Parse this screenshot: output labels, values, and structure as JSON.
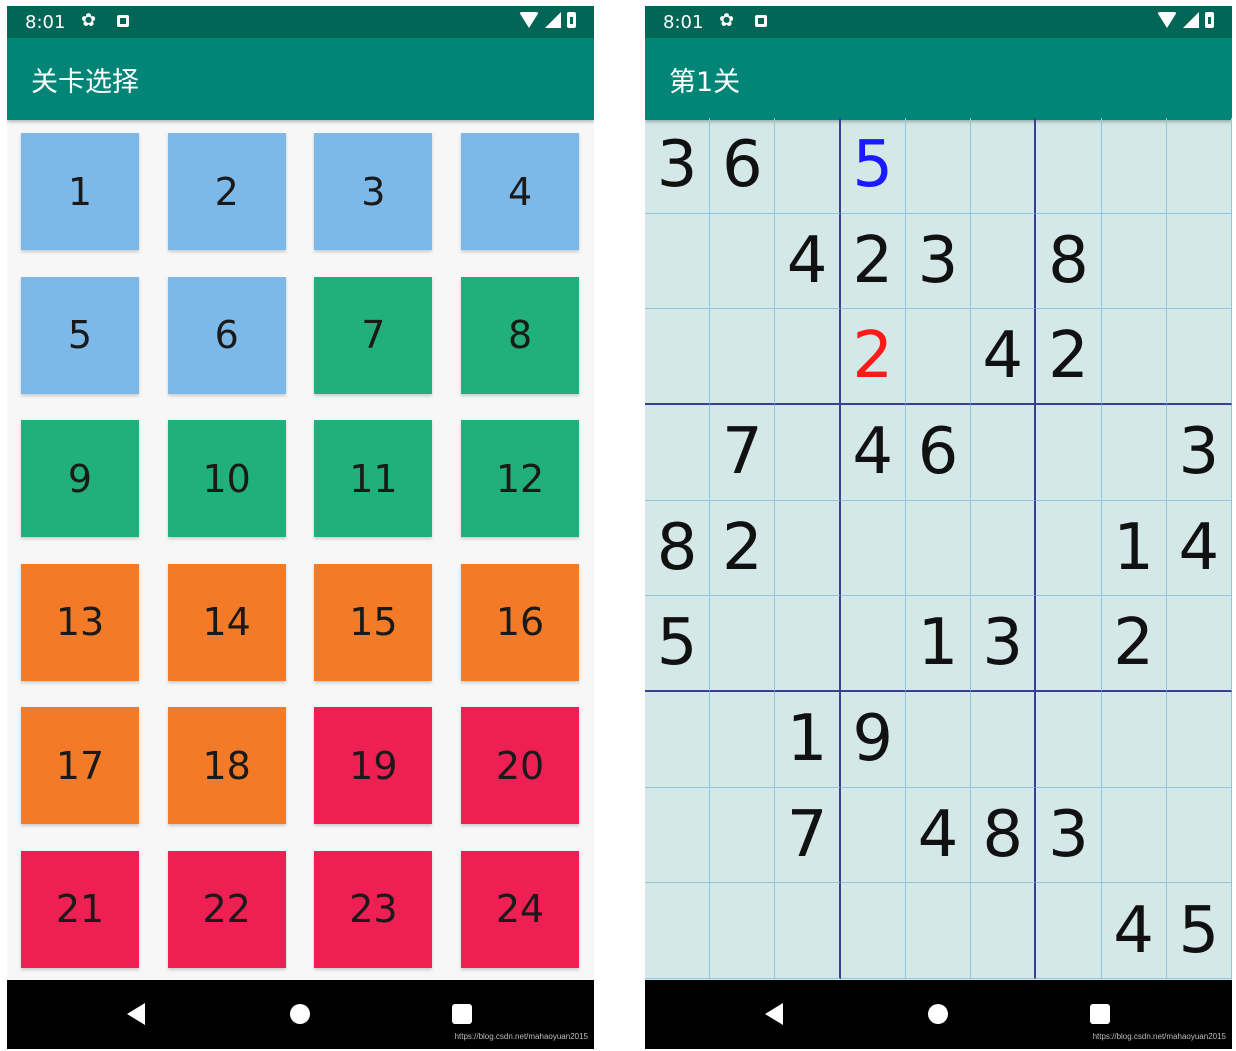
{
  "left_screen": {
    "status": {
      "time": "8:01",
      "icons": [
        "gear-icon",
        "a-icon",
        "wifi-icon",
        "signal-icon",
        "battery-icon"
      ]
    },
    "title": "关卡选择",
    "levels": [
      {
        "n": "1",
        "color": "#7db9e8"
      },
      {
        "n": "2",
        "color": "#7db9e8"
      },
      {
        "n": "3",
        "color": "#7db9e8"
      },
      {
        "n": "4",
        "color": "#7db9e8"
      },
      {
        "n": "5",
        "color": "#7db9e8"
      },
      {
        "n": "6",
        "color": "#7db9e8"
      },
      {
        "n": "7",
        "color": "#21b07b"
      },
      {
        "n": "8",
        "color": "#21b07b"
      },
      {
        "n": "9",
        "color": "#21b07b"
      },
      {
        "n": "10",
        "color": "#21b07b"
      },
      {
        "n": "11",
        "color": "#21b07b"
      },
      {
        "n": "12",
        "color": "#21b07b"
      },
      {
        "n": "13",
        "color": "#f37b27"
      },
      {
        "n": "14",
        "color": "#f37b27"
      },
      {
        "n": "15",
        "color": "#f37b27"
      },
      {
        "n": "16",
        "color": "#f37b27"
      },
      {
        "n": "17",
        "color": "#f37b27"
      },
      {
        "n": "18",
        "color": "#f37b27"
      },
      {
        "n": "19",
        "color": "#ee1f52"
      },
      {
        "n": "20",
        "color": "#ee1f52"
      },
      {
        "n": "21",
        "color": "#ee1f52"
      },
      {
        "n": "22",
        "color": "#ee1f52"
      },
      {
        "n": "23",
        "color": "#ee1f52"
      },
      {
        "n": "24",
        "color": "#ee1f52"
      }
    ],
    "watermark": "https://blog.csdn.net/mahaoyuan2015"
  },
  "right_screen": {
    "status": {
      "time": "8:01"
    },
    "title": "第1关",
    "board": [
      [
        "3",
        "6",
        "",
        "5",
        "",
        "",
        "",
        "",
        ""
      ],
      [
        "",
        "",
        "4",
        "2",
        "3",
        "",
        "8",
        "",
        ""
      ],
      [
        "",
        "",
        "",
        "2",
        "",
        "4",
        "2",
        "",
        ""
      ],
      [
        "",
        "7",
        "",
        "4",
        "6",
        "",
        "",
        "",
        "3"
      ],
      [
        "8",
        "2",
        "",
        "",
        "",
        "",
        "",
        "1",
        "4"
      ],
      [
        "5",
        "",
        "",
        "",
        "1",
        "3",
        "",
        "2",
        ""
      ],
      [
        "",
        "",
        "1",
        "9",
        "",
        "",
        "",
        "",
        ""
      ],
      [
        "",
        "",
        "7",
        "",
        "4",
        "8",
        "3",
        "",
        ""
      ],
      [
        "",
        "",
        "",
        "",
        "",
        "",
        "",
        "4",
        "5"
      ]
    ],
    "cell_colors": {
      "0-3": "blue",
      "2-3": "red"
    },
    "watermark": "https://blog.csdn.net/mahaoyuan2015"
  }
}
